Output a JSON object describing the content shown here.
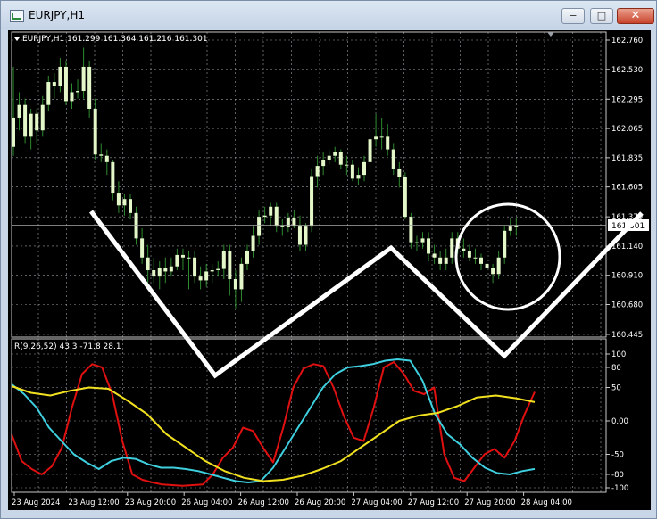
{
  "window": {
    "title": "EURJPY,H1",
    "buttons": {
      "minimize": "−",
      "maximize": "□",
      "close": "✕"
    }
  },
  "price_panel": {
    "header": "EURJPY,H1  161.299 161.364 161.216 161.301",
    "current_price": "161.301",
    "price_ticks": [
      "162.760",
      "162.530",
      "162.295",
      "162.065",
      "161.835",
      "161.605",
      "161.370",
      "161.140",
      "160.910",
      "160.680",
      "160.445"
    ]
  },
  "indicator_panel": {
    "header": "R(9,26,52) 43.3 -71.8 28.1",
    "ticks": [
      "100",
      "80",
      "50",
      "0.00",
      "-50",
      "-80",
      "-100"
    ]
  },
  "time_axis": [
    "23 Aug 2024",
    "23 Aug 12:00",
    "23 Aug 20:00",
    "26 Aug 04:00",
    "26 Aug 12:00",
    "26 Aug 20:00",
    "27 Aug 04:00",
    "27 Aug 12:00",
    "27 Aug 20:00",
    "28 Aug 04:00"
  ],
  "colors": {
    "background": "#000000",
    "grid": "#9aa0a6",
    "candle_body": "#e4f7c8",
    "candle_wick": "#2e8b2e",
    "series_red": "#e01010",
    "series_cyan": "#3fd0e0",
    "series_yellow": "#f0e020",
    "annotation": "#ffffff"
  },
  "chart_data": [
    {
      "type": "candlestick",
      "title": "EURJPY,H1",
      "ylim": [
        160.445,
        162.76
      ],
      "open": [
        161.92,
        162.15,
        162.25,
        162.0,
        162.18,
        162.05,
        162.25,
        162.43,
        162.4,
        162.55,
        162.28,
        162.35,
        162.36,
        162.55,
        162.22,
        161.86,
        161.85,
        161.8,
        161.56,
        161.46,
        161.51,
        161.4,
        161.2,
        161.05,
        160.95,
        160.9,
        160.97,
        160.94,
        160.98,
        161.07,
        161.05,
        161.05,
        160.9,
        160.87,
        160.94,
        160.95,
        160.96,
        161.1,
        160.88,
        160.8,
        161.0,
        161.1,
        161.22,
        161.37,
        161.38,
        161.45,
        161.3,
        161.29,
        161.36,
        161.3,
        161.15,
        161.3,
        161.69,
        161.77,
        161.82,
        161.85,
        161.88,
        161.78,
        161.78,
        161.67,
        161.7,
        161.8,
        161.98,
        162.0,
        162.0,
        161.9,
        161.75,
        161.68,
        161.37,
        161.17,
        161.17,
        161.2,
        161.08,
        161.05,
        161.0,
        161.05,
        161.2,
        161.12,
        161.1,
        161.05,
        161.05,
        161.0,
        160.97,
        160.92,
        161.05,
        161.26,
        161.3
      ],
      "close": [
        162.15,
        162.25,
        162.0,
        162.18,
        162.05,
        162.25,
        162.43,
        162.4,
        162.55,
        162.28,
        162.35,
        162.36,
        162.55,
        162.22,
        161.86,
        161.85,
        161.8,
        161.56,
        161.46,
        161.51,
        161.4,
        161.2,
        161.05,
        160.95,
        160.9,
        160.97,
        160.94,
        160.98,
        161.07,
        161.05,
        161.05,
        160.9,
        160.87,
        160.94,
        160.95,
        160.96,
        161.1,
        160.88,
        160.8,
        161.0,
        161.1,
        161.22,
        161.37,
        161.38,
        161.45,
        161.3,
        161.29,
        161.36,
        161.3,
        161.15,
        161.3,
        161.69,
        161.77,
        161.82,
        161.85,
        161.88,
        161.78,
        161.78,
        161.67,
        161.7,
        161.8,
        161.98,
        162.0,
        162.0,
        161.9,
        161.75,
        161.68,
        161.37,
        161.17,
        161.17,
        161.2,
        161.08,
        161.05,
        161.0,
        161.05,
        161.2,
        161.12,
        161.1,
        161.05,
        161.05,
        161.0,
        160.97,
        160.92,
        161.05,
        161.26,
        161.3,
        161.3
      ],
      "high": [
        162.55,
        162.35,
        162.3,
        162.22,
        162.22,
        162.32,
        162.48,
        162.5,
        162.62,
        162.6,
        162.42,
        162.45,
        162.7,
        162.6,
        162.3,
        161.95,
        161.9,
        161.82,
        161.65,
        161.55,
        161.55,
        161.45,
        161.28,
        161.15,
        161.05,
        161.02,
        161.05,
        161.05,
        161.12,
        161.12,
        161.1,
        161.1,
        160.98,
        161.0,
        161.0,
        161.02,
        161.15,
        161.15,
        160.95,
        161.05,
        161.15,
        161.3,
        161.42,
        161.45,
        161.48,
        161.48,
        161.35,
        161.4,
        161.42,
        161.38,
        161.32,
        161.75,
        161.85,
        161.88,
        161.9,
        161.92,
        161.9,
        161.85,
        161.82,
        161.76,
        161.85,
        162.02,
        162.18,
        162.15,
        162.1,
        161.95,
        161.8,
        161.72,
        161.4,
        161.22,
        161.25,
        161.25,
        161.15,
        161.1,
        161.12,
        161.25,
        161.25,
        161.2,
        161.15,
        161.12,
        161.08,
        161.05,
        161.0,
        161.1,
        161.3,
        161.36,
        161.36
      ],
      "low": [
        161.85,
        162.05,
        161.95,
        161.9,
        161.95,
        162.0,
        162.2,
        162.3,
        162.35,
        162.25,
        162.22,
        162.3,
        162.3,
        162.15,
        161.82,
        161.8,
        161.7,
        161.5,
        161.4,
        161.38,
        161.35,
        161.15,
        161.0,
        160.85,
        160.85,
        160.8,
        160.85,
        160.9,
        160.95,
        160.95,
        160.8,
        160.85,
        160.8,
        160.82,
        160.85,
        160.9,
        160.88,
        160.75,
        160.65,
        160.7,
        160.95,
        161.05,
        161.15,
        161.32,
        161.3,
        161.25,
        161.22,
        161.25,
        161.28,
        161.1,
        161.1,
        161.25,
        161.6,
        161.7,
        161.78,
        161.8,
        161.75,
        161.7,
        161.65,
        161.62,
        161.65,
        161.75,
        161.92,
        161.9,
        161.85,
        161.7,
        161.6,
        161.35,
        161.12,
        161.1,
        161.12,
        161.02,
        161.0,
        160.95,
        160.95,
        161.0,
        161.08,
        161.05,
        161.02,
        161.0,
        160.95,
        160.9,
        160.85,
        160.88,
        161.0,
        161.22,
        161.22
      ]
    },
    {
      "type": "line",
      "title": "R(9,26,52) 43.3 -71.8 28.1",
      "ylim": [
        -100,
        100
      ],
      "series": [
        {
          "values": [
            -20,
            -60,
            -72,
            -80,
            -68,
            -40,
            20,
            70,
            85,
            80,
            40,
            -30,
            -80,
            -88,
            -92,
            -95,
            -96,
            -97,
            -96,
            -95,
            -80,
            -55,
            -40,
            -10,
            -15,
            -40,
            -62,
            -10,
            50,
            78,
            85,
            82,
            50,
            8,
            -25,
            -30,
            20,
            80,
            88,
            70,
            45,
            40,
            50,
            -50,
            -85,
            -90,
            -70,
            -50,
            -42,
            -55,
            -30,
            10,
            43.3
          ]
        },
        {
          "values": [
            55,
            40,
            20,
            -10,
            -30,
            -50,
            -62,
            -72,
            -60,
            -55,
            -57,
            -65,
            -70,
            -70,
            -72,
            -75,
            -80,
            -85,
            -90,
            -92,
            -90,
            -70,
            -40,
            -10,
            20,
            50,
            70,
            80,
            82,
            85,
            90,
            92,
            90,
            60,
            10,
            -20,
            -35,
            -55,
            -70,
            -78,
            -80,
            -75,
            -71.8
          ]
        },
        {
          "values": [
            52,
            42,
            38,
            45,
            50,
            48,
            30,
            10,
            -20,
            -40,
            -60,
            -75,
            -85,
            -90,
            -88,
            -82,
            -72,
            -60,
            -40,
            -20,
            0,
            8,
            12,
            22,
            35,
            38,
            34,
            28.1
          ]
        }
      ]
    }
  ],
  "annotations": {
    "v_pattern_line": "white zig-zag line",
    "circle_marker": "white circle"
  }
}
